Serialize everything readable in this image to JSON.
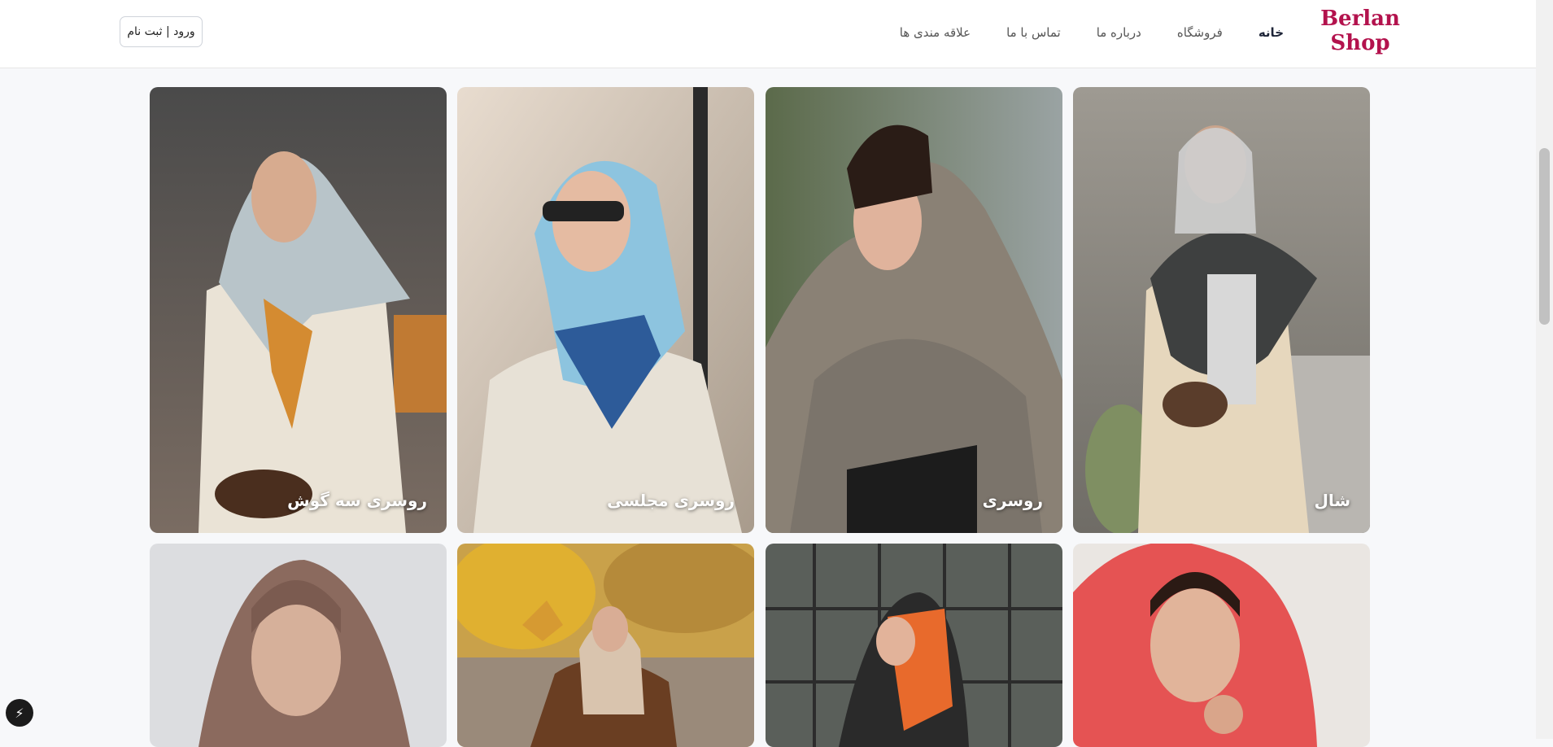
{
  "brand": {
    "line1": "Berlan",
    "line2": "Shop",
    "color": "#b3124d"
  },
  "nav": {
    "items": [
      {
        "label": "خانه",
        "active": true
      },
      {
        "label": "فروشگاه",
        "active": false
      },
      {
        "label": "درباره ما",
        "active": false
      },
      {
        "label": "تماس با ما",
        "active": false
      },
      {
        "label": "علاقه مندی ها",
        "active": false
      }
    ],
    "auth_label": "ورود | ثبت نام"
  },
  "categories": [
    {
      "label": "شال"
    },
    {
      "label": "روسری"
    },
    {
      "label": "روسری مجلسی"
    },
    {
      "label": "روسری سه گوش"
    }
  ],
  "fab_icon": "lightning-icon"
}
